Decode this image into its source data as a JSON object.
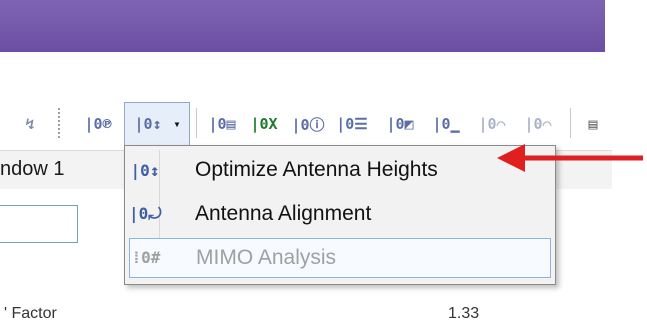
{
  "window": {
    "tab_label": "ndow 1"
  },
  "toolbar": {
    "icons": [
      {
        "name": "network-icon",
        "sym": "↯"
      },
      {
        "name": "report-p-icon",
        "sym": "|0℗"
      },
      {
        "name": "optimize-heights-dropdown-icon",
        "sym": "|0↕"
      },
      {
        "name": "report-sheet-icon",
        "sym": "|0▤"
      },
      {
        "name": "excel-export-icon",
        "sym": "|0X"
      },
      {
        "name": "report-info-icon",
        "sym": "|0ⓘ"
      },
      {
        "name": "report-list-icon",
        "sym": "|0☰"
      },
      {
        "name": "report-chart-icon",
        "sym": "|0◩"
      },
      {
        "name": "report-bar-icon",
        "sym": "|0▁"
      },
      {
        "name": "report-disabled-1-icon",
        "sym": "|0⌒"
      },
      {
        "name": "report-disabled-2-icon",
        "sym": "|0⌒"
      },
      {
        "name": "document-icon",
        "sym": "▤"
      }
    ]
  },
  "menu": {
    "items": [
      {
        "label": "Optimize Antenna Heights",
        "icon": "|0↕",
        "enabled": true
      },
      {
        "label": "Antenna Alignment",
        "icon": "|0⤾",
        "enabled": true
      },
      {
        "label": "MIMO Analysis",
        "icon": "⁞0#",
        "enabled": false
      }
    ]
  },
  "background": {
    "left_text": "' Factor",
    "right_text": "1.33"
  },
  "colors": {
    "titlebar": "#6c4fa3",
    "arrow": "#e02020",
    "icon_blue": "#3f5fa8"
  }
}
